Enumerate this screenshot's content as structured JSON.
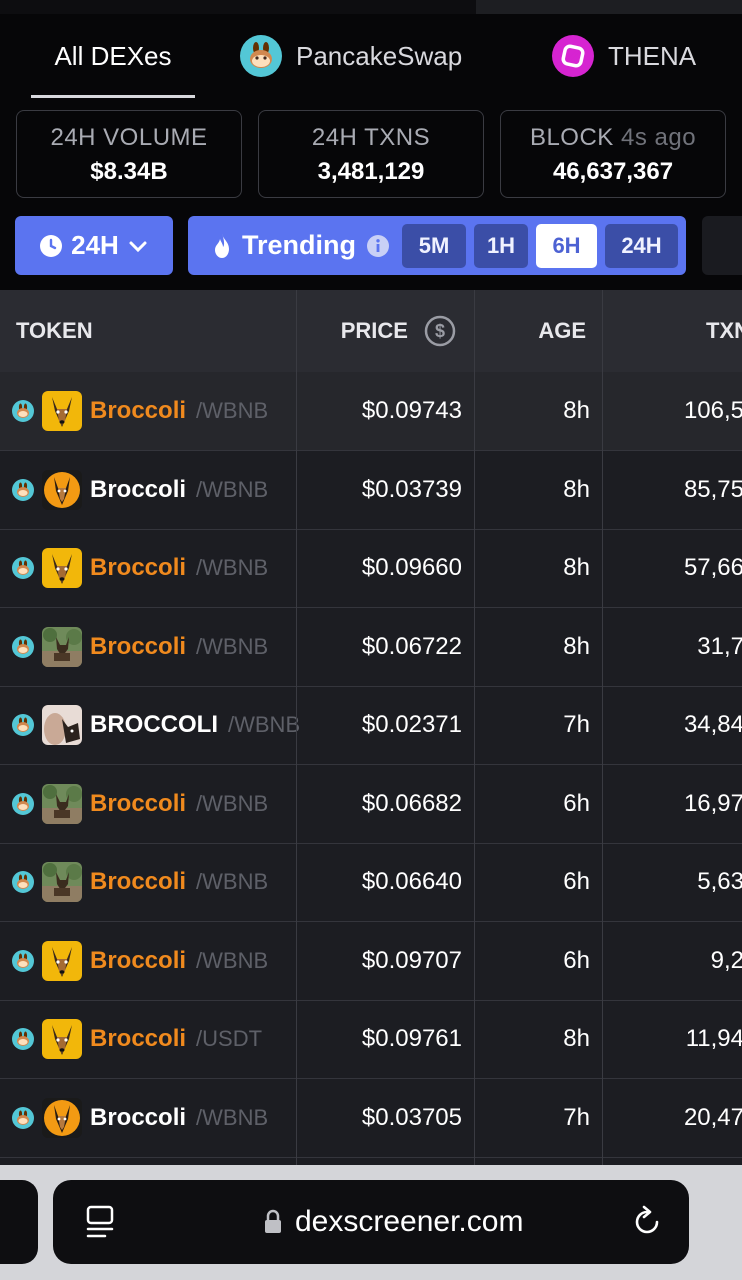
{
  "tabs": [
    {
      "label": "All DEXes",
      "active": true
    },
    {
      "label": "PancakeSwap",
      "icon": "pancakeswap-bunny-icon"
    },
    {
      "label": "THENA",
      "icon": "thena-logo-icon"
    }
  ],
  "stats": [
    {
      "label": "24H VOLUME",
      "value": "$8.34B"
    },
    {
      "label": "24H TXNS",
      "value": "3,481,129"
    },
    {
      "label": "BLOCK",
      "sub": "4s ago",
      "value": "46,637,367"
    }
  ],
  "filters": {
    "period": "24H",
    "trending_label": "Trending",
    "ranges": [
      "5M",
      "1H",
      "6H",
      "24H"
    ],
    "selected_range": "6H"
  },
  "table": {
    "headers": {
      "token": "TOKEN",
      "price": "PRICE",
      "age": "AGE",
      "txns": "TXN"
    },
    "rows": [
      {
        "symbol": "Broccoli",
        "quote": "/WBNB",
        "price": "$0.09743",
        "age": "8h",
        "txns": "106,5",
        "color": "orange",
        "avatar": "dog-gold"
      },
      {
        "symbol": "Broccoli",
        "quote": "/WBNB",
        "price": "$0.03739",
        "age": "8h",
        "txns": "85,75",
        "color": "white",
        "avatar": "dog-sun"
      },
      {
        "symbol": "Broccoli",
        "quote": "/WBNB",
        "price": "$0.09660",
        "age": "8h",
        "txns": "57,66",
        "color": "orange",
        "avatar": "dog-gold"
      },
      {
        "symbol": "Broccoli",
        "quote": "/WBNB",
        "price": "$0.06722",
        "age": "8h",
        "txns": "31,7",
        "color": "orange",
        "avatar": "dog-photo"
      },
      {
        "symbol": "BROCCOLI",
        "quote": "/WBNB",
        "price": "$0.02371",
        "age": "7h",
        "txns": "34,84",
        "color": "white",
        "avatar": "dog-person"
      },
      {
        "symbol": "Broccoli",
        "quote": "/WBNB",
        "price": "$0.06682",
        "age": "6h",
        "txns": "16,97",
        "color": "orange",
        "avatar": "dog-photo"
      },
      {
        "symbol": "Broccoli",
        "quote": "/WBNB",
        "price": "$0.06640",
        "age": "6h",
        "txns": "5,63",
        "color": "orange",
        "avatar": "dog-photo"
      },
      {
        "symbol": "Broccoli",
        "quote": "/WBNB",
        "price": "$0.09707",
        "age": "6h",
        "txns": "9,2",
        "color": "orange",
        "avatar": "dog-gold"
      },
      {
        "symbol": "Broccoli",
        "quote": "/USDT",
        "price": "$0.09761",
        "age": "8h",
        "txns": "11,94",
        "color": "orange",
        "avatar": "dog-gold"
      },
      {
        "symbol": "Broccoli",
        "quote": "/WBNB",
        "price": "$0.03705",
        "age": "7h",
        "txns": "20,47",
        "color": "white",
        "avatar": "dog-sun"
      }
    ]
  },
  "browser": {
    "url": "dexscreener.com"
  },
  "colors": {
    "accent": "#5b74f0",
    "orange": "#f08a1e",
    "bg": "#0b0b0f"
  }
}
